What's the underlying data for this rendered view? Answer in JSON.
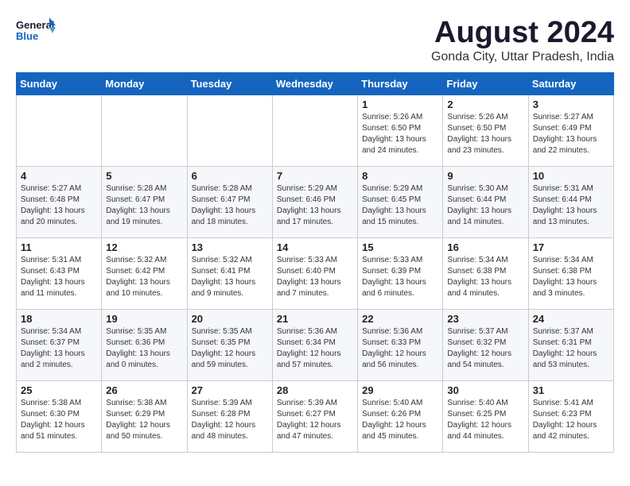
{
  "header": {
    "logo_line1": "General",
    "logo_line2": "Blue",
    "month_title": "August 2024",
    "subtitle": "Gonda City, Uttar Pradesh, India"
  },
  "weekdays": [
    "Sunday",
    "Monday",
    "Tuesday",
    "Wednesday",
    "Thursday",
    "Friday",
    "Saturday"
  ],
  "weeks": [
    [
      {
        "num": "",
        "info": ""
      },
      {
        "num": "",
        "info": ""
      },
      {
        "num": "",
        "info": ""
      },
      {
        "num": "",
        "info": ""
      },
      {
        "num": "1",
        "info": "Sunrise: 5:26 AM\nSunset: 6:50 PM\nDaylight: 13 hours\nand 24 minutes."
      },
      {
        "num": "2",
        "info": "Sunrise: 5:26 AM\nSunset: 6:50 PM\nDaylight: 13 hours\nand 23 minutes."
      },
      {
        "num": "3",
        "info": "Sunrise: 5:27 AM\nSunset: 6:49 PM\nDaylight: 13 hours\nand 22 minutes."
      }
    ],
    [
      {
        "num": "4",
        "info": "Sunrise: 5:27 AM\nSunset: 6:48 PM\nDaylight: 13 hours\nand 20 minutes."
      },
      {
        "num": "5",
        "info": "Sunrise: 5:28 AM\nSunset: 6:47 PM\nDaylight: 13 hours\nand 19 minutes."
      },
      {
        "num": "6",
        "info": "Sunrise: 5:28 AM\nSunset: 6:47 PM\nDaylight: 13 hours\nand 18 minutes."
      },
      {
        "num": "7",
        "info": "Sunrise: 5:29 AM\nSunset: 6:46 PM\nDaylight: 13 hours\nand 17 minutes."
      },
      {
        "num": "8",
        "info": "Sunrise: 5:29 AM\nSunset: 6:45 PM\nDaylight: 13 hours\nand 15 minutes."
      },
      {
        "num": "9",
        "info": "Sunrise: 5:30 AM\nSunset: 6:44 PM\nDaylight: 13 hours\nand 14 minutes."
      },
      {
        "num": "10",
        "info": "Sunrise: 5:31 AM\nSunset: 6:44 PM\nDaylight: 13 hours\nand 13 minutes."
      }
    ],
    [
      {
        "num": "11",
        "info": "Sunrise: 5:31 AM\nSunset: 6:43 PM\nDaylight: 13 hours\nand 11 minutes."
      },
      {
        "num": "12",
        "info": "Sunrise: 5:32 AM\nSunset: 6:42 PM\nDaylight: 13 hours\nand 10 minutes."
      },
      {
        "num": "13",
        "info": "Sunrise: 5:32 AM\nSunset: 6:41 PM\nDaylight: 13 hours\nand 9 minutes."
      },
      {
        "num": "14",
        "info": "Sunrise: 5:33 AM\nSunset: 6:40 PM\nDaylight: 13 hours\nand 7 minutes."
      },
      {
        "num": "15",
        "info": "Sunrise: 5:33 AM\nSunset: 6:39 PM\nDaylight: 13 hours\nand 6 minutes."
      },
      {
        "num": "16",
        "info": "Sunrise: 5:34 AM\nSunset: 6:38 PM\nDaylight: 13 hours\nand 4 minutes."
      },
      {
        "num": "17",
        "info": "Sunrise: 5:34 AM\nSunset: 6:38 PM\nDaylight: 13 hours\nand 3 minutes."
      }
    ],
    [
      {
        "num": "18",
        "info": "Sunrise: 5:34 AM\nSunset: 6:37 PM\nDaylight: 13 hours\nand 2 minutes."
      },
      {
        "num": "19",
        "info": "Sunrise: 5:35 AM\nSunset: 6:36 PM\nDaylight: 13 hours\nand 0 minutes."
      },
      {
        "num": "20",
        "info": "Sunrise: 5:35 AM\nSunset: 6:35 PM\nDaylight: 12 hours\nand 59 minutes."
      },
      {
        "num": "21",
        "info": "Sunrise: 5:36 AM\nSunset: 6:34 PM\nDaylight: 12 hours\nand 57 minutes."
      },
      {
        "num": "22",
        "info": "Sunrise: 5:36 AM\nSunset: 6:33 PM\nDaylight: 12 hours\nand 56 minutes."
      },
      {
        "num": "23",
        "info": "Sunrise: 5:37 AM\nSunset: 6:32 PM\nDaylight: 12 hours\nand 54 minutes."
      },
      {
        "num": "24",
        "info": "Sunrise: 5:37 AM\nSunset: 6:31 PM\nDaylight: 12 hours\nand 53 minutes."
      }
    ],
    [
      {
        "num": "25",
        "info": "Sunrise: 5:38 AM\nSunset: 6:30 PM\nDaylight: 12 hours\nand 51 minutes."
      },
      {
        "num": "26",
        "info": "Sunrise: 5:38 AM\nSunset: 6:29 PM\nDaylight: 12 hours\nand 50 minutes."
      },
      {
        "num": "27",
        "info": "Sunrise: 5:39 AM\nSunset: 6:28 PM\nDaylight: 12 hours\nand 48 minutes."
      },
      {
        "num": "28",
        "info": "Sunrise: 5:39 AM\nSunset: 6:27 PM\nDaylight: 12 hours\nand 47 minutes."
      },
      {
        "num": "29",
        "info": "Sunrise: 5:40 AM\nSunset: 6:26 PM\nDaylight: 12 hours\nand 45 minutes."
      },
      {
        "num": "30",
        "info": "Sunrise: 5:40 AM\nSunset: 6:25 PM\nDaylight: 12 hours\nand 44 minutes."
      },
      {
        "num": "31",
        "info": "Sunrise: 5:41 AM\nSunset: 6:23 PM\nDaylight: 12 hours\nand 42 minutes."
      }
    ]
  ]
}
